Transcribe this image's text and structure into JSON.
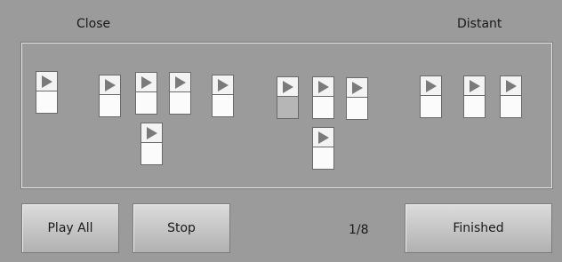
{
  "labels": {
    "close": "Close",
    "distant": "Distant"
  },
  "clips": [
    {
      "id": 1
    },
    {
      "id": 2
    },
    {
      "id": 3
    },
    {
      "id": 4
    },
    {
      "id": 5
    },
    {
      "id": 6
    },
    {
      "id": 7,
      "active": true
    },
    {
      "id": 8
    },
    {
      "id": 9
    },
    {
      "id": 10
    },
    {
      "id": 11
    },
    {
      "id": 12
    },
    {
      "id": 13
    }
  ],
  "buttons": {
    "play_all": "Play All",
    "stop": "Stop",
    "finished": "Finished"
  },
  "counter": "1/8",
  "icons": {
    "clip_play": "play-triangle-icon"
  }
}
